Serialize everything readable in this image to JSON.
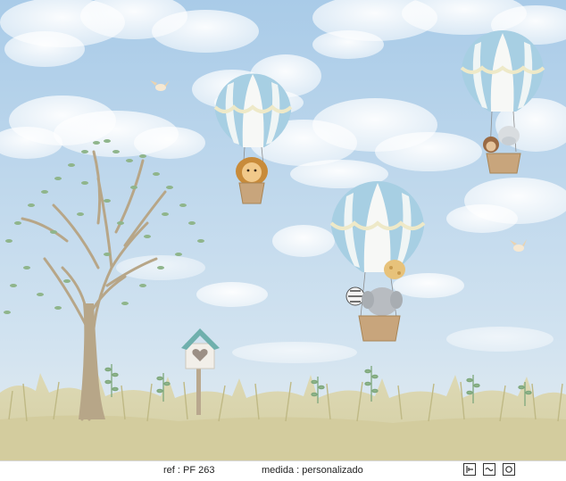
{
  "footer": {
    "ref": "ref : PF 263",
    "measure": "medida : personalizado",
    "icons": [
      "wall-fit-icon",
      "wave-pattern-icon",
      "circle-icon"
    ]
  },
  "colors": {
    "sky_top": "#a9cbe8",
    "sky_bottom": "#dde9f1",
    "grass": "#d8d3a8",
    "balloon_blue": "#a7cfe3",
    "balloon_white": "#f7f8f6",
    "basket": "#c8a57c",
    "birdhouse_roof": "#6fb0ad",
    "tree_trunk": "#b7a688",
    "leaf": "#8fb58b"
  }
}
